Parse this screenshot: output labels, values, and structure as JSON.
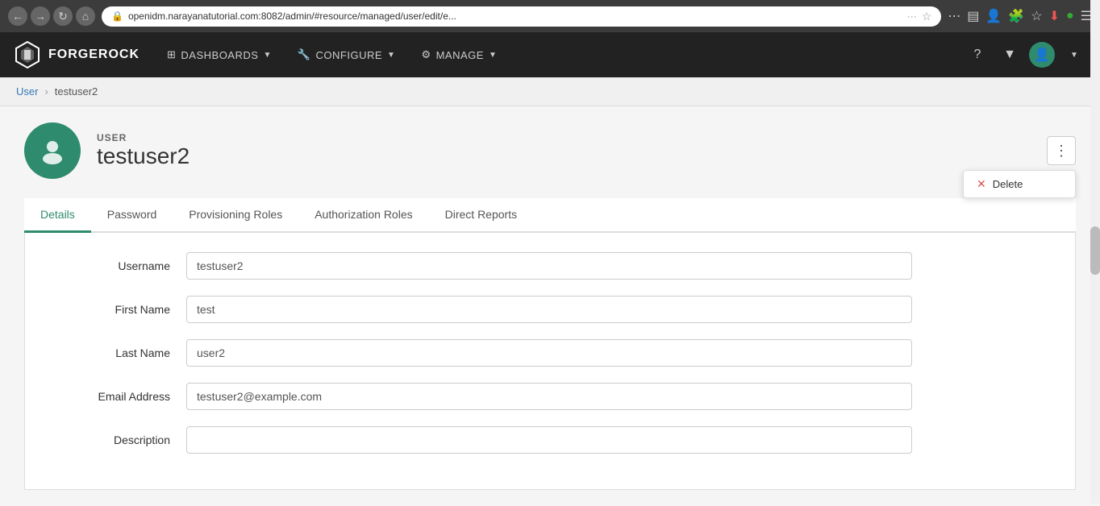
{
  "browser": {
    "url": "openidm.narayanatutorial.com:8082/admin/#resource/managed/user/edit/e...",
    "nav_back": "←",
    "nav_forward": "→",
    "nav_refresh": "↻",
    "nav_home": "⌂"
  },
  "navbar": {
    "brand": "FORGEROCK",
    "items": [
      {
        "id": "dashboards",
        "label": "DASHBOARDS",
        "icon": "⊞"
      },
      {
        "id": "configure",
        "label": "CONFIGURE",
        "icon": "🔧"
      },
      {
        "id": "manage",
        "label": "MANAGE",
        "icon": "⚙"
      }
    ]
  },
  "breadcrumb": {
    "parent": "User",
    "separator": "›",
    "current": "testuser2"
  },
  "user_header": {
    "label": "USER",
    "name": "testuser2"
  },
  "dropdown": {
    "delete_label": "Delete"
  },
  "tabs": [
    {
      "id": "details",
      "label": "Details",
      "active": true
    },
    {
      "id": "password",
      "label": "Password",
      "active": false
    },
    {
      "id": "provisioning-roles",
      "label": "Provisioning Roles",
      "active": false
    },
    {
      "id": "authorization-roles",
      "label": "Authorization Roles",
      "active": false
    },
    {
      "id": "direct-reports",
      "label": "Direct Reports",
      "active": false
    }
  ],
  "form": {
    "fields": [
      {
        "id": "username",
        "label": "Username",
        "value": "testuser2",
        "placeholder": ""
      },
      {
        "id": "first-name",
        "label": "First Name",
        "value": "test",
        "placeholder": ""
      },
      {
        "id": "last-name",
        "label": "Last Name",
        "value": "user2",
        "placeholder": ""
      },
      {
        "id": "email-address",
        "label": "Email Address",
        "value": "testuser2@example.com",
        "placeholder": ""
      },
      {
        "id": "description",
        "label": "Description",
        "value": "",
        "placeholder": ""
      }
    ]
  }
}
